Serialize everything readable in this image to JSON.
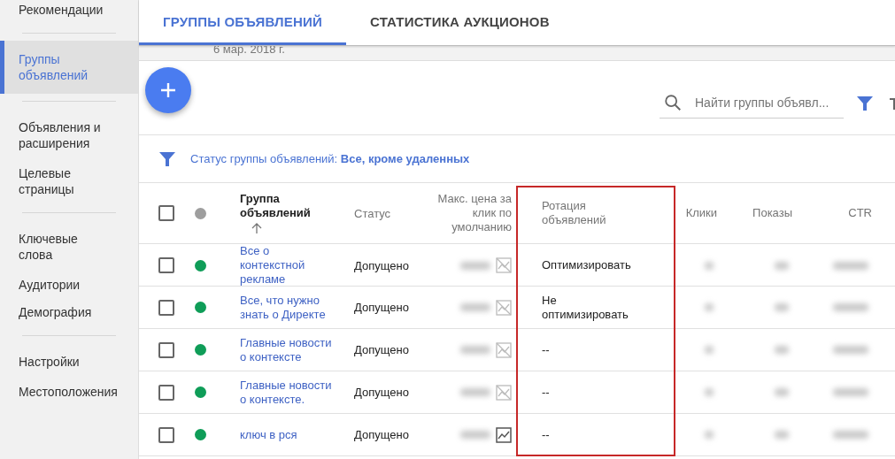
{
  "sidebar": {
    "items": [
      {
        "label": "Рекомендации",
        "selected": false,
        "divider_after": true
      },
      {
        "label": "Группы объявлений",
        "selected": true,
        "divider_after": true
      },
      {
        "label": "Объявления и расширения",
        "selected": false,
        "divider_after": false
      },
      {
        "label": "Целевые страницы",
        "selected": false,
        "divider_after": true
      },
      {
        "label": "Ключевые слова",
        "selected": false,
        "divider_after": false
      },
      {
        "label": "Аудитории",
        "selected": false,
        "divider_after": false
      },
      {
        "label": "Демография",
        "selected": false,
        "divider_after": true
      },
      {
        "label": "Настройки",
        "selected": false,
        "divider_after": false
      },
      {
        "label": "Местоположения",
        "selected": false,
        "divider_after": false
      }
    ]
  },
  "tabs": [
    {
      "label": "ГРУППЫ ОБЪЯВЛЕНИЙ",
      "selected": true
    },
    {
      "label": "СТАТИСТИКА АУКЦИОНОВ",
      "selected": false
    }
  ],
  "date_note": "6 мар. 2018 г.",
  "search": {
    "placeholder": "Найти группы объявл..."
  },
  "filter": {
    "label": "Статус группы объявлений: ",
    "value": "Все, кроме удаленных"
  },
  "table": {
    "columns": [
      "Группа объявлений",
      "Статус",
      "Макс. цена за клик по умолчанию",
      "Ротация объявлений",
      "Клики",
      "Показы",
      "CTR"
    ],
    "all_checked": false,
    "rows": [
      {
        "name": "Все о контекстной рекламе",
        "status": "Допущено",
        "rotation": "Оптимизировать",
        "checked": false,
        "color": "#0f9d58",
        "has_data": false
      },
      {
        "name": "Все, что нужно знать о Директе",
        "status": "Допущено",
        "rotation": "Не оптимизировать",
        "checked": false,
        "color": "#0f9d58",
        "has_data": false
      },
      {
        "name": "Главные новости о контексте",
        "status": "Допущено",
        "rotation": "--",
        "checked": false,
        "color": "#0f9d58",
        "has_data": false
      },
      {
        "name": "Главные новости о контексте.",
        "status": "Допущено",
        "rotation": "--",
        "checked": false,
        "color": "#0f9d58",
        "has_data": false
      },
      {
        "name": "ключ в рся",
        "status": "Допущено",
        "rotation": "--",
        "checked": false,
        "color": "#0f9d58",
        "has_data": true
      }
    ]
  }
}
